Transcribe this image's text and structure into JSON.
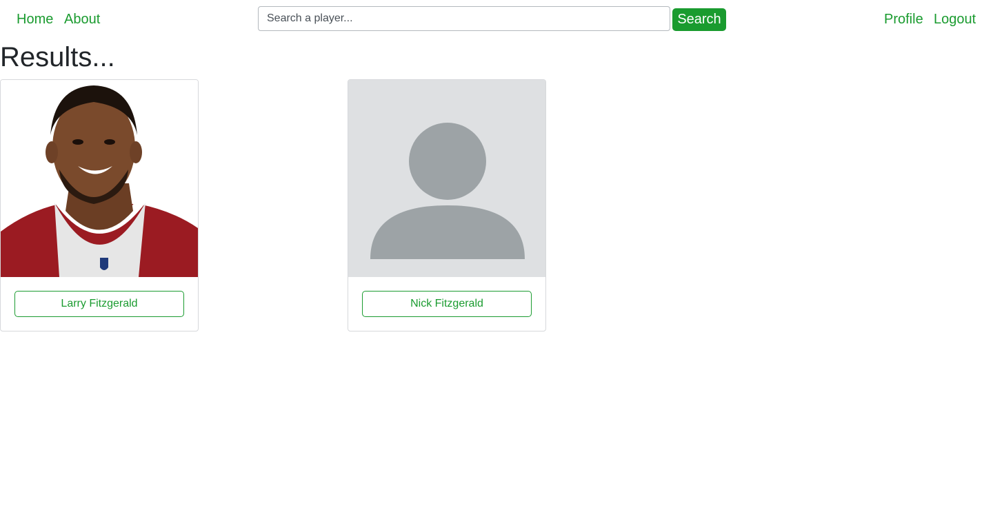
{
  "nav": {
    "home_label": "Home",
    "about_label": "About",
    "profile_label": "Profile",
    "logout_label": "Logout"
  },
  "search": {
    "placeholder": "Search a player...",
    "value": "",
    "button_label": "Search"
  },
  "main": {
    "title": "Results...",
    "results": [
      {
        "name": "Larry Fitzgerald",
        "image": "player-photo"
      },
      {
        "name": "Nick Fitzgerald",
        "image": "default-avatar-icon"
      }
    ]
  },
  "colors": {
    "accent": "#1a9b2f",
    "jersey": "#9b1b22",
    "avatar_bg": "#dee0e2",
    "avatar_fg": "#9da3a6"
  }
}
